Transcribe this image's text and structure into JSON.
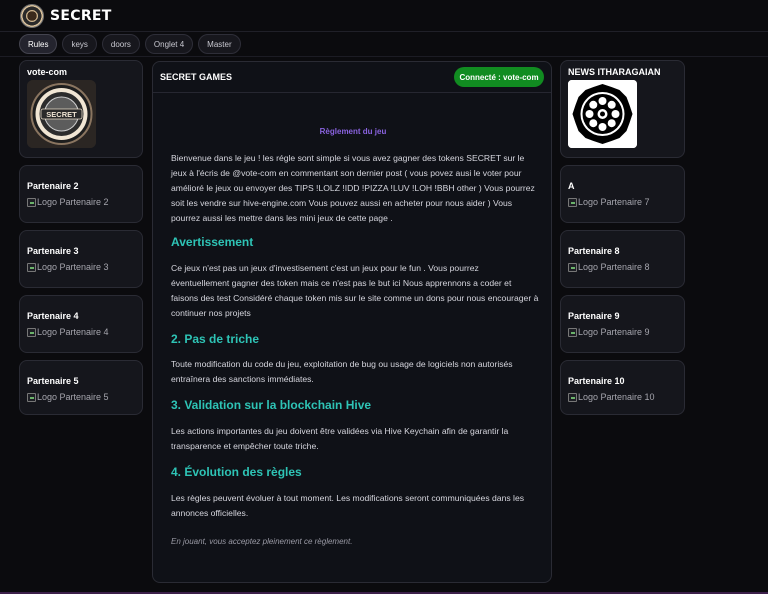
{
  "header": {
    "brand": "SECRET",
    "logo_icon": "secret-coin-logo"
  },
  "tabs": [
    {
      "label": "Rules",
      "active": true
    },
    {
      "label": "keys",
      "active": false
    },
    {
      "label": "doors",
      "active": false
    },
    {
      "label": "Onglet 4",
      "active": false
    },
    {
      "label": "Master",
      "active": false
    }
  ],
  "left": [
    {
      "title": "vote-com",
      "image": "secret-coin"
    },
    {
      "title": "Partenaire 2",
      "alt": "Logo Partenaire 2"
    },
    {
      "title": "Partenaire 3",
      "alt": "Logo Partenaire 3"
    },
    {
      "title": "Partenaire 4",
      "alt": "Logo Partenaire 4"
    },
    {
      "title": "Partenaire 5",
      "alt": "Logo Partenaire 5"
    }
  ],
  "right": [
    {
      "title": "NEWS ITHARAGAIAN",
      "image": "news-emblem"
    },
    {
      "title": "A",
      "alt": "Logo Partenaire 7"
    },
    {
      "title": "Partenaire 8",
      "alt": "Logo Partenaire 8"
    },
    {
      "title": "Partenaire 9",
      "alt": "Logo Partenaire 9"
    },
    {
      "title": "Partenaire 10",
      "alt": "Logo Partenaire 10"
    }
  ],
  "main": {
    "title": "SECRET GAMES",
    "status": "Connecté : vote-com",
    "status_color": "#118c21",
    "rules_heading": "Règlement du jeu",
    "intro": "Bienvenue dans le jeu ! les régle sont simple si vous avez gagner des tokens SECRET sur le jeux à l'écris de @vote-com en commentant son dernier post ( vous povez ausi le voter pour amélioré le jeux ou envoyer des TIPS !LOLZ !IDD !PIZZA !LUV !LOH !BBH other ) Vous pourrez soit les vendre sur hive-engine.com Vous pouvez aussi en acheter pour nous aider ) Vous pourrez aussi les mettre dans les mini jeux de cette page .",
    "sections": [
      {
        "heading": "Avertissement",
        "text": "Ce jeux n'est pas un jeux d'investisement c'est un jeux pour le fun . Vous pourrez éventuellement gagner des token mais ce n'est pas le but ici Nous apprennons a coder et faisons des test Considéré chaque token mis sur le site comme un dons pour nous encourager à continuer nos projets"
      },
      {
        "heading": "2. Pas de triche",
        "text": "Toute modification du code du jeu, exploitation de bug ou usage de logiciels non autorisés entraînera des sanctions immédiates."
      },
      {
        "heading": "3. Validation sur la blockchain Hive",
        "text": "Les actions importantes du jeu doivent être validées via Hive Keychain afin de garantir la transparence et empêcher toute triche."
      },
      {
        "heading": "4. Évolution des règles",
        "text": "Les règles peuvent évoluer à tout moment. Les modifications seront communiquées dans les annonces officielles."
      }
    ],
    "footer": "En jouant, vous acceptez pleinement ce règlement."
  }
}
